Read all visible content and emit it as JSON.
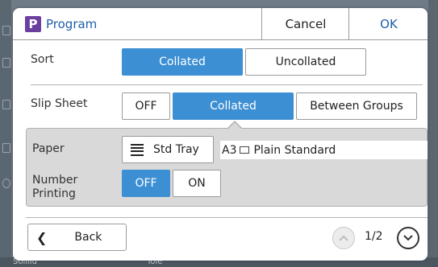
{
  "dialog": {
    "icon_letter": "P",
    "title": "Program",
    "cancel_label": "Cancel",
    "ok_label": "OK"
  },
  "sort": {
    "label": "Sort",
    "options": [
      "Collated",
      "Uncollated"
    ],
    "selected": "Collated"
  },
  "slip_sheet": {
    "label": "Slip Sheet",
    "options": [
      "OFF",
      "Collated",
      "Between Groups"
    ],
    "selected": "Collated"
  },
  "paper": {
    "label": "Paper",
    "tray_label": "Std Tray",
    "size": "A3",
    "type": "Plain Standard"
  },
  "number_printing": {
    "label_line1": "Number",
    "label_line2": "Printing",
    "options": [
      "OFF",
      "ON"
    ],
    "selected": "OFF"
  },
  "footer": {
    "back_label": "Back",
    "page_indicator": "1/2"
  },
  "background": {
    "bottom_left_text": "Sollilu",
    "bottom_mid_text": "Tole"
  },
  "colors": {
    "accent": "#3d8fd4",
    "title_blue": "#1f5ea8",
    "icon_purple": "#6a3fa0"
  }
}
